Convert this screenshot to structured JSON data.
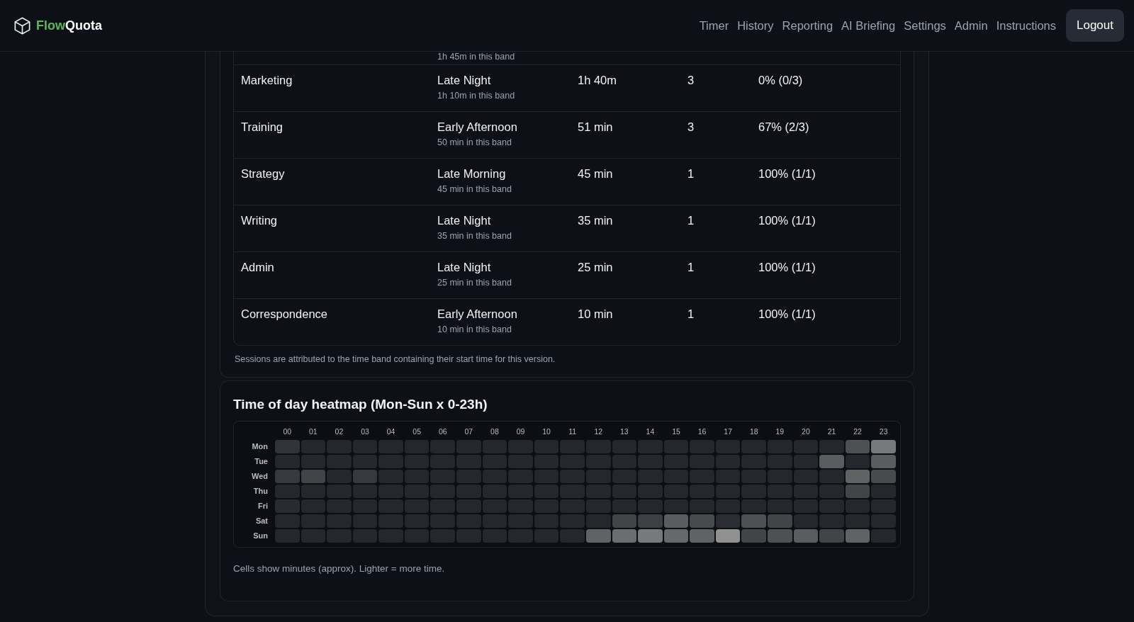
{
  "brand": {
    "first": "Flow",
    "second": "Quota"
  },
  "nav": [
    {
      "label": "Timer",
      "kind": "link"
    },
    {
      "label": "History",
      "kind": "link"
    },
    {
      "label": "Reporting",
      "kind": "link"
    },
    {
      "label": "AI Briefing",
      "kind": "link"
    },
    {
      "label": "Settings",
      "kind": "link"
    },
    {
      "label": "Admin",
      "kind": "link"
    },
    {
      "label": "Instructions",
      "kind": "link"
    },
    {
      "label": "Logout",
      "kind": "button"
    }
  ],
  "table": {
    "rows": [
      {
        "kind": "partial",
        "band_note": "1h 45m in this band"
      },
      {
        "kind": "full",
        "project": "Marketing",
        "band": "Late Night",
        "band_note": "1h 10m in this band",
        "total": "1h 40m",
        "sessions": "3",
        "completion": "0% (0/3)"
      },
      {
        "kind": "full",
        "project": "Training",
        "band": "Early Afternoon",
        "band_note": "50 min in this band",
        "total": "51 min",
        "sessions": "3",
        "completion": "67% (2/3)"
      },
      {
        "kind": "full",
        "project": "Strategy",
        "band": "Late Morning",
        "band_note": "45 min in this band",
        "total": "45 min",
        "sessions": "1",
        "completion": "100% (1/1)"
      },
      {
        "kind": "full",
        "project": "Writing",
        "band": "Late Night",
        "band_note": "35 min in this band",
        "total": "35 min",
        "sessions": "1",
        "completion": "100% (1/1)"
      },
      {
        "kind": "full",
        "project": "Admin",
        "band": "Late Night",
        "band_note": "25 min in this band",
        "total": "25 min",
        "sessions": "1",
        "completion": "100% (1/1)"
      },
      {
        "kind": "full",
        "project": "Correspondence",
        "band": "Early Afternoon",
        "band_note": "10 min in this band",
        "total": "10 min",
        "sessions": "1",
        "completion": "100% (1/1)"
      }
    ],
    "note": "Sessions are attributed to the time band containing their start time for this version."
  },
  "heatmap": {
    "title": "Time of day heatmap (Mon-Sun x 0-23h)",
    "hours": [
      "00",
      "01",
      "02",
      "03",
      "04",
      "05",
      "06",
      "07",
      "08",
      "09",
      "10",
      "11",
      "12",
      "13",
      "14",
      "15",
      "16",
      "17",
      "18",
      "19",
      "20",
      "21",
      "22",
      "23"
    ],
    "rows": [
      {
        "day": "Mon",
        "cells": [
          {
            "color": "#303338"
          },
          {
            "color": "#24282d"
          },
          {
            "color": "#24282d"
          },
          {
            "color": "#24282d"
          },
          {
            "color": "#24282d"
          },
          {
            "color": "#24282d"
          },
          {
            "color": "#24282d"
          },
          {
            "color": "#24282d"
          },
          {
            "color": "#24282d"
          },
          {
            "color": "#24282d"
          },
          {
            "color": "#24282d"
          },
          {
            "color": "#24282d"
          },
          {
            "color": "#24282d"
          },
          {
            "color": "#24282d"
          },
          {
            "color": "#24282d"
          },
          {
            "color": "#24282d"
          },
          {
            "color": "#24282d"
          },
          {
            "color": "#24282d"
          },
          {
            "color": "#24282d"
          },
          {
            "color": "#24282d"
          },
          {
            "color": "#24282d"
          },
          {
            "color": "#24282d"
          },
          {
            "color": "#4e5053"
          },
          {
            "color": "#78797a"
          }
        ]
      },
      {
        "day": "Tue",
        "cells": [
          {
            "color": "#24282d"
          },
          {
            "color": "#24282d"
          },
          {
            "color": "#24282d"
          },
          {
            "color": "#24282d"
          },
          {
            "color": "#24282d"
          },
          {
            "color": "#24282d"
          },
          {
            "color": "#24282d"
          },
          {
            "color": "#24282d"
          },
          {
            "color": "#24282d"
          },
          {
            "color": "#24282d"
          },
          {
            "color": "#24282d"
          },
          {
            "color": "#24282d"
          },
          {
            "color": "#24282d"
          },
          {
            "color": "#24282d"
          },
          {
            "color": "#24282d"
          },
          {
            "color": "#24282d"
          },
          {
            "color": "#24282d"
          },
          {
            "color": "#24282d"
          },
          {
            "color": "#24282d"
          },
          {
            "color": "#24282d"
          },
          {
            "color": "#24282d"
          },
          {
            "color": "#5a5c5f"
          },
          {
            "color": "#24282d"
          },
          {
            "color": "#5a5c5f"
          }
        ]
      },
      {
        "day": "Wed",
        "cells": [
          {
            "color": "#36393d"
          },
          {
            "color": "#424548"
          },
          {
            "color": "#24282d"
          },
          {
            "color": "#36393d"
          },
          {
            "color": "#24282d"
          },
          {
            "color": "#24282d"
          },
          {
            "color": "#24282d"
          },
          {
            "color": "#24282d"
          },
          {
            "color": "#24282d"
          },
          {
            "color": "#24282d"
          },
          {
            "color": "#24282d"
          },
          {
            "color": "#24282d"
          },
          {
            "color": "#24282d"
          },
          {
            "color": "#24282d"
          },
          {
            "color": "#24282d"
          },
          {
            "color": "#24282d"
          },
          {
            "color": "#24282d"
          },
          {
            "color": "#24282d"
          },
          {
            "color": "#24282d"
          },
          {
            "color": "#24282d"
          },
          {
            "color": "#24282d"
          },
          {
            "color": "#24282d"
          },
          {
            "color": "#606264"
          },
          {
            "color": "#484b4e"
          }
        ]
      },
      {
        "day": "Thu",
        "cells": [
          {
            "color": "#24282d"
          },
          {
            "color": "#24282d"
          },
          {
            "color": "#24282d"
          },
          {
            "color": "#24282d"
          },
          {
            "color": "#24282d"
          },
          {
            "color": "#24282d"
          },
          {
            "color": "#24282d"
          },
          {
            "color": "#24282d"
          },
          {
            "color": "#24282d"
          },
          {
            "color": "#24282d"
          },
          {
            "color": "#24282d"
          },
          {
            "color": "#24282d"
          },
          {
            "color": "#24282d"
          },
          {
            "color": "#24282d"
          },
          {
            "color": "#24282d"
          },
          {
            "color": "#24282d"
          },
          {
            "color": "#24282d"
          },
          {
            "color": "#24282d"
          },
          {
            "color": "#24282d"
          },
          {
            "color": "#24282d"
          },
          {
            "color": "#24282d"
          },
          {
            "color": "#24282d"
          },
          {
            "color": "#424548"
          },
          {
            "color": "#24282d"
          }
        ]
      },
      {
        "day": "Fri",
        "cells": [
          {
            "color": "#282b30"
          },
          {
            "color": "#24282d"
          },
          {
            "color": "#24282d"
          },
          {
            "color": "#24282d"
          },
          {
            "color": "#24282d"
          },
          {
            "color": "#24282d"
          },
          {
            "color": "#24282d"
          },
          {
            "color": "#24282d"
          },
          {
            "color": "#24282d"
          },
          {
            "color": "#24282d"
          },
          {
            "color": "#24282d"
          },
          {
            "color": "#24282d"
          },
          {
            "color": "#24282d"
          },
          {
            "color": "#24282d"
          },
          {
            "color": "#24282d"
          },
          {
            "color": "#24282d"
          },
          {
            "color": "#24282d"
          },
          {
            "color": "#24282d"
          },
          {
            "color": "#24282d"
          },
          {
            "color": "#24282d"
          },
          {
            "color": "#24282d"
          },
          {
            "color": "#24282d"
          },
          {
            "color": "#24282d"
          },
          {
            "color": "#24282d"
          }
        ]
      },
      {
        "day": "Sat",
        "cells": [
          {
            "color": "#24282d"
          },
          {
            "color": "#24282d"
          },
          {
            "color": "#24282d"
          },
          {
            "color": "#24282d"
          },
          {
            "color": "#24282d"
          },
          {
            "color": "#24282d"
          },
          {
            "color": "#24282d"
          },
          {
            "color": "#24282d"
          },
          {
            "color": "#24282d"
          },
          {
            "color": "#24282d"
          },
          {
            "color": "#24282d"
          },
          {
            "color": "#24282d"
          },
          {
            "color": "#24282d"
          },
          {
            "color": "#424548"
          },
          {
            "color": "#3c3f43"
          },
          {
            "color": "#5a5c5f"
          },
          {
            "color": "#484b4e"
          },
          {
            "color": "#2a2e32"
          },
          {
            "color": "#4e5053"
          },
          {
            "color": "#424548"
          },
          {
            "color": "#24282d"
          },
          {
            "color": "#24282d"
          },
          {
            "color": "#24282d"
          },
          {
            "color": "#24282d"
          }
        ]
      },
      {
        "day": "Sun",
        "cells": [
          {
            "color": "#24282d"
          },
          {
            "color": "#24282d"
          },
          {
            "color": "#24282d"
          },
          {
            "color": "#24282d"
          },
          {
            "color": "#24282d"
          },
          {
            "color": "#24282d"
          },
          {
            "color": "#24282d"
          },
          {
            "color": "#24282d"
          },
          {
            "color": "#24282d"
          },
          {
            "color": "#24282d"
          },
          {
            "color": "#24282d"
          },
          {
            "color": "#24282d"
          },
          {
            "color": "#606264"
          },
          {
            "color": "#6c6d6f"
          },
          {
            "color": "#78797a"
          },
          {
            "color": "#66686a"
          },
          {
            "color": "#606264"
          },
          {
            "color": "#909090"
          },
          {
            "color": "#424548"
          },
          {
            "color": "#4e5053"
          },
          {
            "color": "#5a5c5f"
          },
          {
            "color": "#424548"
          },
          {
            "color": "#606264"
          },
          {
            "color": "#24282d"
          }
        ]
      }
    ],
    "caption": "Cells show minutes (approx). Lighter = more time."
  }
}
